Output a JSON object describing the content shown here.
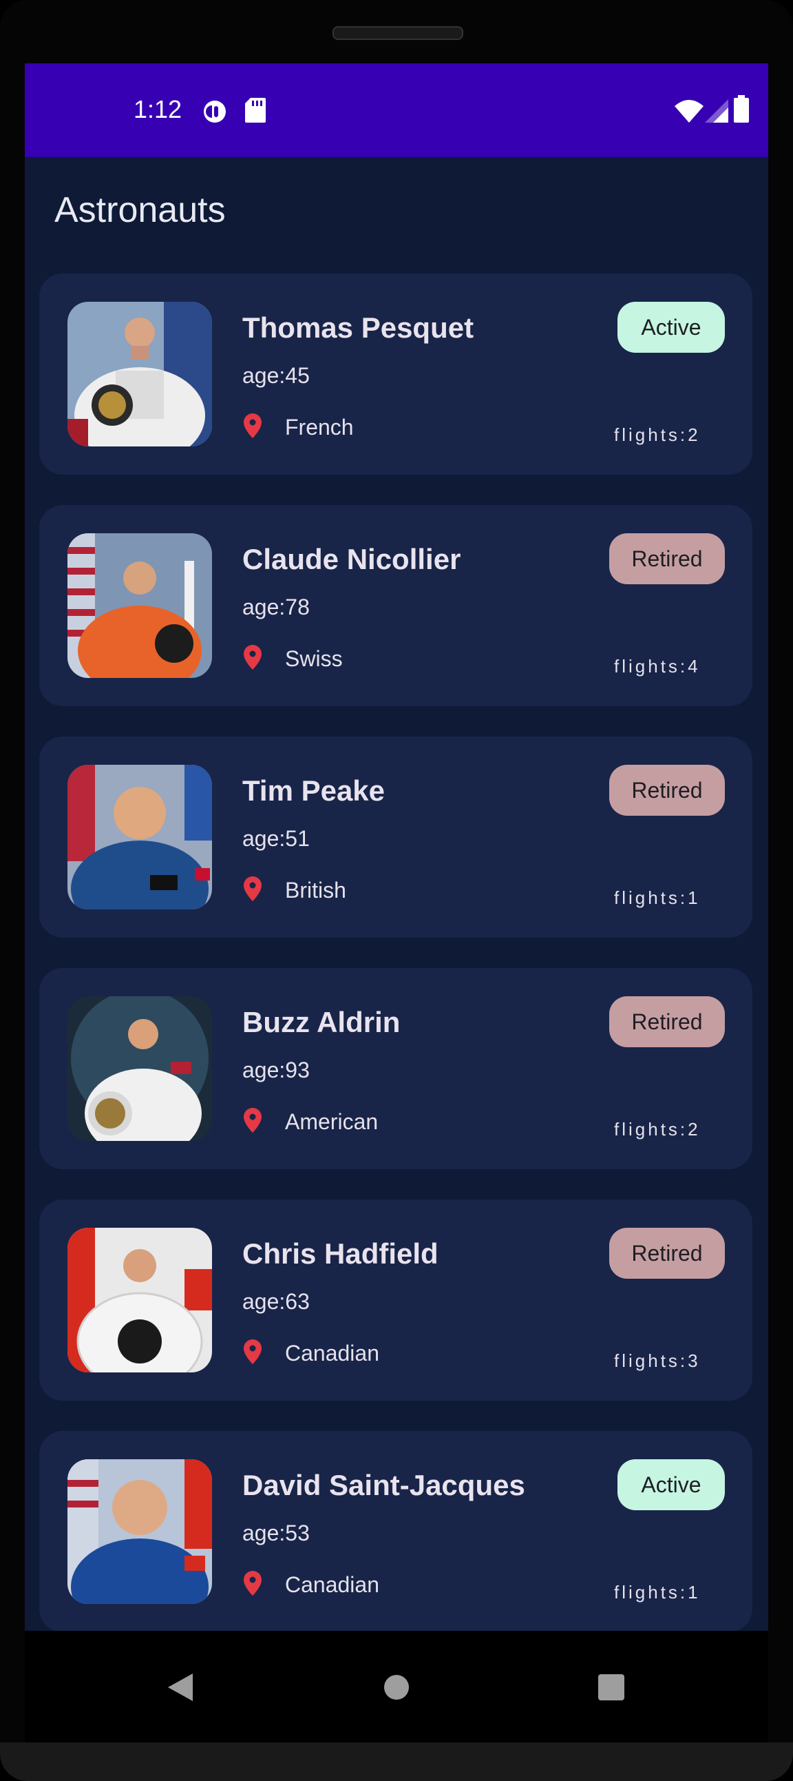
{
  "status_bar": {
    "time": "1:12",
    "icons": [
      "data-saver-icon",
      "sd-card-icon",
      "wifi-icon",
      "signal-icon",
      "battery-icon"
    ]
  },
  "app": {
    "title": "Astronauts"
  },
  "astronauts": [
    {
      "name": "Thomas Pesquet",
      "age": "age:45",
      "nationality": "French",
      "flights": "flights:2",
      "status": "Active"
    },
    {
      "name": "Claude Nicollier",
      "age": "age:78",
      "nationality": "Swiss",
      "flights": "flights:4",
      "status": "Retired"
    },
    {
      "name": "Tim Peake",
      "age": "age:51",
      "nationality": "British",
      "flights": "flights:1",
      "status": "Retired"
    },
    {
      "name": "Buzz Aldrin",
      "age": "age:93",
      "nationality": "American",
      "flights": "flights:2",
      "status": "Retired"
    },
    {
      "name": "Chris Hadfield",
      "age": "age:63",
      "nationality": "Canadian",
      "flights": "flights:3",
      "status": "Retired"
    },
    {
      "name": "David Saint-Jacques",
      "age": "age:53",
      "nationality": "Canadian",
      "flights": "flights:1",
      "status": "Active"
    }
  ],
  "colors": {
    "status_bar": "#3700b3",
    "background": "#0e1a36",
    "card": "#182548",
    "active_badge": "#c6f5e1",
    "retired_badge": "#c59ea2",
    "pin": "#e53946"
  },
  "nav_bar": {
    "icons": [
      "back-icon",
      "home-icon",
      "recents-icon"
    ]
  }
}
